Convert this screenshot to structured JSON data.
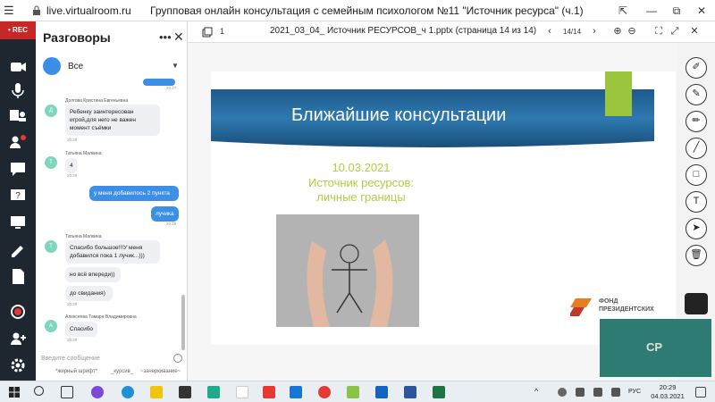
{
  "browser": {
    "url": "live.virtualroom.ru",
    "title": "Групповая онлайн консультация с семейным психологом №11 \"Источник ресурса\" (ч.1)",
    "buttons": [
      "⇱",
      "—",
      "⧉",
      "✕"
    ]
  },
  "rail": {
    "rec_label": "• REC"
  },
  "chat": {
    "header": "Разговоры",
    "selector": "Все",
    "input_placeholder": "Введите сообщение",
    "format": [
      "*жирный шрифт*",
      "_курсив_",
      "~зачеркивание~"
    ],
    "messages": [
      {
        "time_top": "20:4?",
        "author": "Долгова Кристина Евгеньевна",
        "initial": "Д",
        "text": "Ребенку заинтересован игрой,для него не важен момент съёмки",
        "time": "20:28"
      },
      {
        "author": "Татьяна Малкина",
        "initial": "Т",
        "text": "4",
        "time": "20:28"
      },
      {
        "self": true,
        "text": "у меня добавилось 2 пункта",
        "time": ""
      },
      {
        "self": true,
        "text": "лучика",
        "time": "20:29"
      },
      {
        "author": "Татьяна Малкина",
        "initial": "Т",
        "text": "Спасибо большое!!!У меня добавился пока 1 лучик...)))",
        "time": ""
      },
      {
        "text": "но всё впереди))",
        "time": ""
      },
      {
        "text": "до свидания)",
        "time": "20:29"
      },
      {
        "author": "Алексеева Тамара Владимировна",
        "initial": "А",
        "text": "Спасибо",
        "time": "20:29"
      }
    ]
  },
  "doc": {
    "page_num": "1",
    "filename": "2021_03_04_ Источник РЕСУРСОВ_ч 1.pptx (страница 14 из 14)",
    "counter": "14/14"
  },
  "slide": {
    "title": "Ближайшие консультации",
    "date": "10.03.2021",
    "line1": "Источник ресурсов:",
    "line2": "личные границы",
    "fund_line1": "ФОНД",
    "fund_line2": "ПРЕЗИДЕНТСКИХ"
  },
  "video": {
    "initials": "СР"
  },
  "taskbar": {
    "time": "20:29",
    "date": "04.03.2021",
    "lang": "РУС"
  },
  "colors": {
    "accent": "#3d8fe6",
    "rec": "#c62828",
    "slide_green": "#b5cc42",
    "video_bg": "#2e7b73"
  }
}
